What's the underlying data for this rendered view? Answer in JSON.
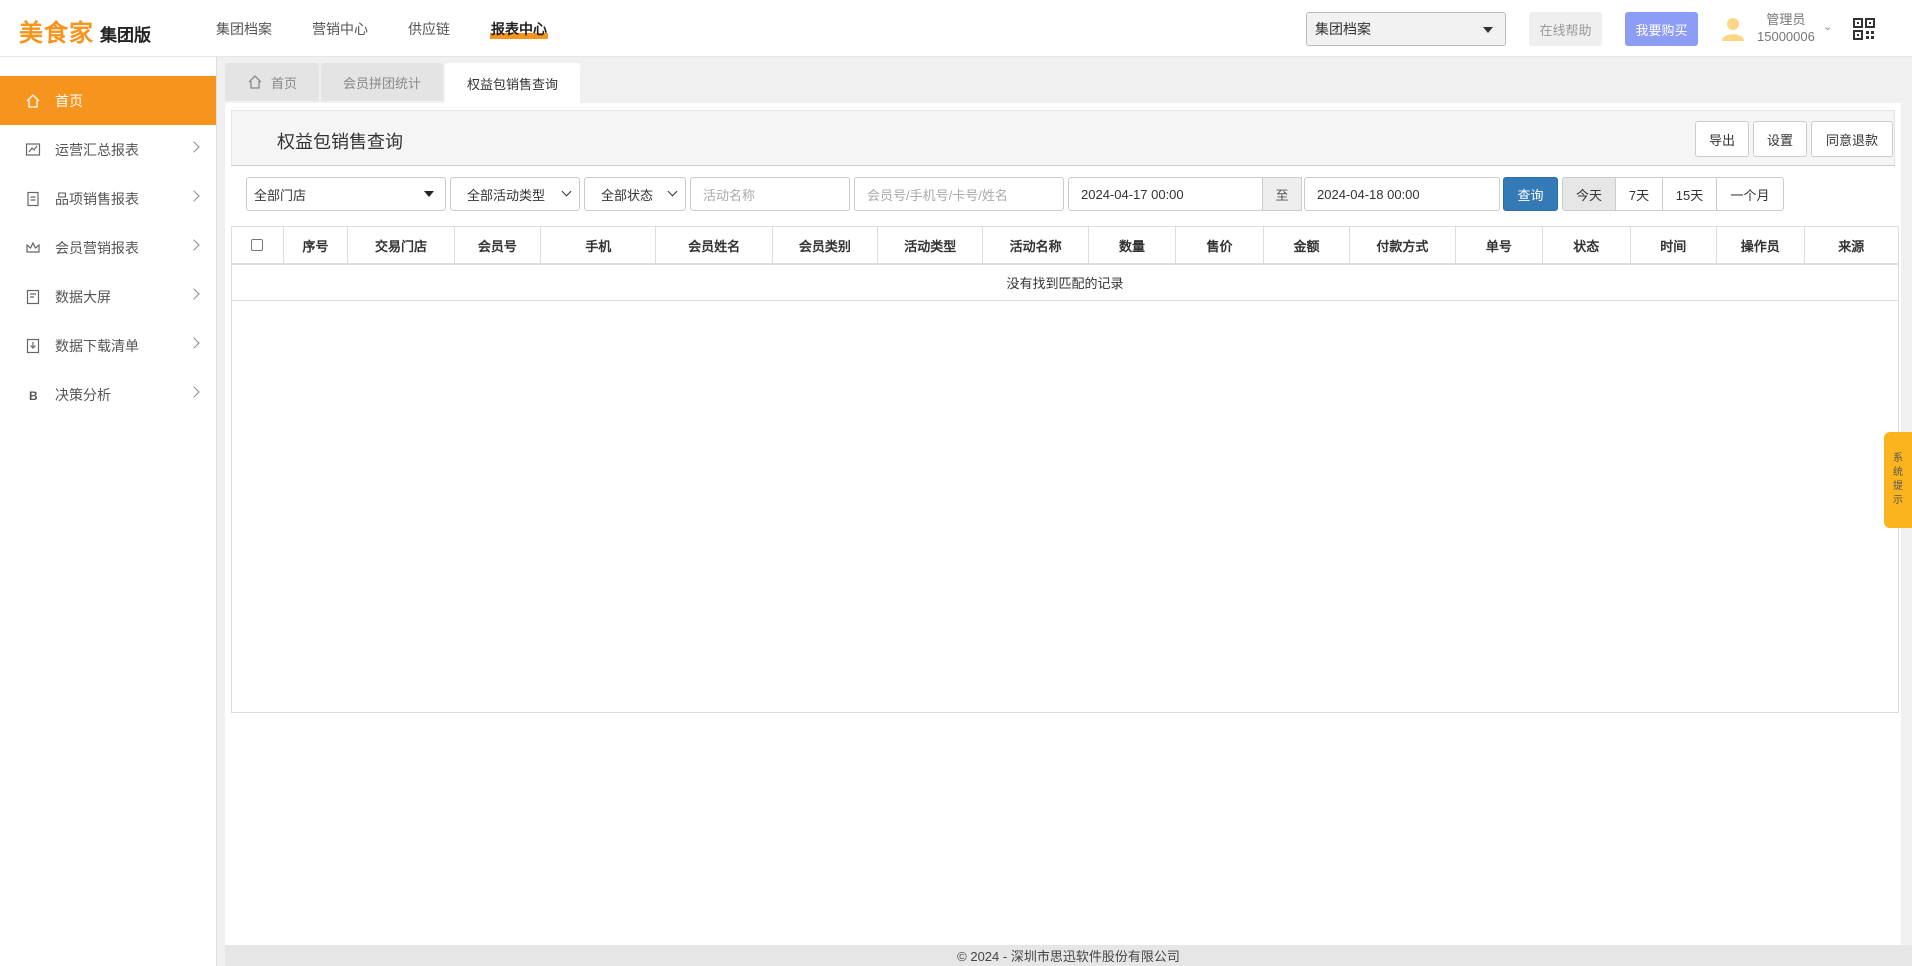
{
  "header": {
    "brand": "美食家",
    "edition": "集团版",
    "nav": [
      "集团档案",
      "营销中心",
      "供应链",
      "报表中心"
    ],
    "active_nav": "报表中心",
    "store_select": "集团档案",
    "help_label": "在线帮助",
    "buy_label": "我要购买",
    "user_role": "管理员",
    "user_id": "15000006"
  },
  "sidebar": {
    "items": [
      {
        "label": "首页",
        "icon": "home-icon",
        "active": true
      },
      {
        "label": "运营汇总报表",
        "icon": "chart-icon"
      },
      {
        "label": "品项销售报表",
        "icon": "document-icon"
      },
      {
        "label": "会员营销报表",
        "icon": "crown-icon"
      },
      {
        "label": "数据大屏",
        "icon": "screen-icon"
      },
      {
        "label": "数据下载清单",
        "icon": "download-icon"
      },
      {
        "label": "决策分析",
        "icon": "bitcoin-icon"
      }
    ]
  },
  "tabs": [
    {
      "label": "首页"
    },
    {
      "label": "会员拼团统计"
    },
    {
      "label": "权益包销售查询",
      "active": true
    }
  ],
  "page": {
    "title": "权益包销售查询",
    "export_label": "导出",
    "settings_label": "设置",
    "refund_label": "同意退款"
  },
  "filters": {
    "store": "全部门店",
    "activity_type": "全部活动类型",
    "status": "全部状态",
    "activity_name_placeholder": "活动名称",
    "member_placeholder": "会员号/手机号/卡号/姓名",
    "start_time": "2024-04-17 00:00",
    "to_label": "至",
    "end_time": "2024-04-18 00:00",
    "query_label": "查询",
    "ranges": [
      "今天",
      "7天",
      "15天",
      "一个月"
    ]
  },
  "table": {
    "columns": [
      "序号",
      "交易门店",
      "会员号",
      "手机",
      "会员姓名",
      "会员类别",
      "活动类型",
      "活动名称",
      "数量",
      "售价",
      "金额",
      "付款方式",
      "单号",
      "状态",
      "时间",
      "操作员",
      "来源"
    ],
    "empty_text": "没有找到匹配的记录"
  },
  "footer": {
    "text": "© 2024 - 深圳市思迅软件股份有限公司"
  },
  "system_tip": [
    "系",
    "统",
    "提",
    "示"
  ],
  "colors": {
    "brand_orange": "#f7941d",
    "query_blue": "#337ab7",
    "buy_purple": "#8d9cf4",
    "tip_yellow": "#fbb41d"
  }
}
